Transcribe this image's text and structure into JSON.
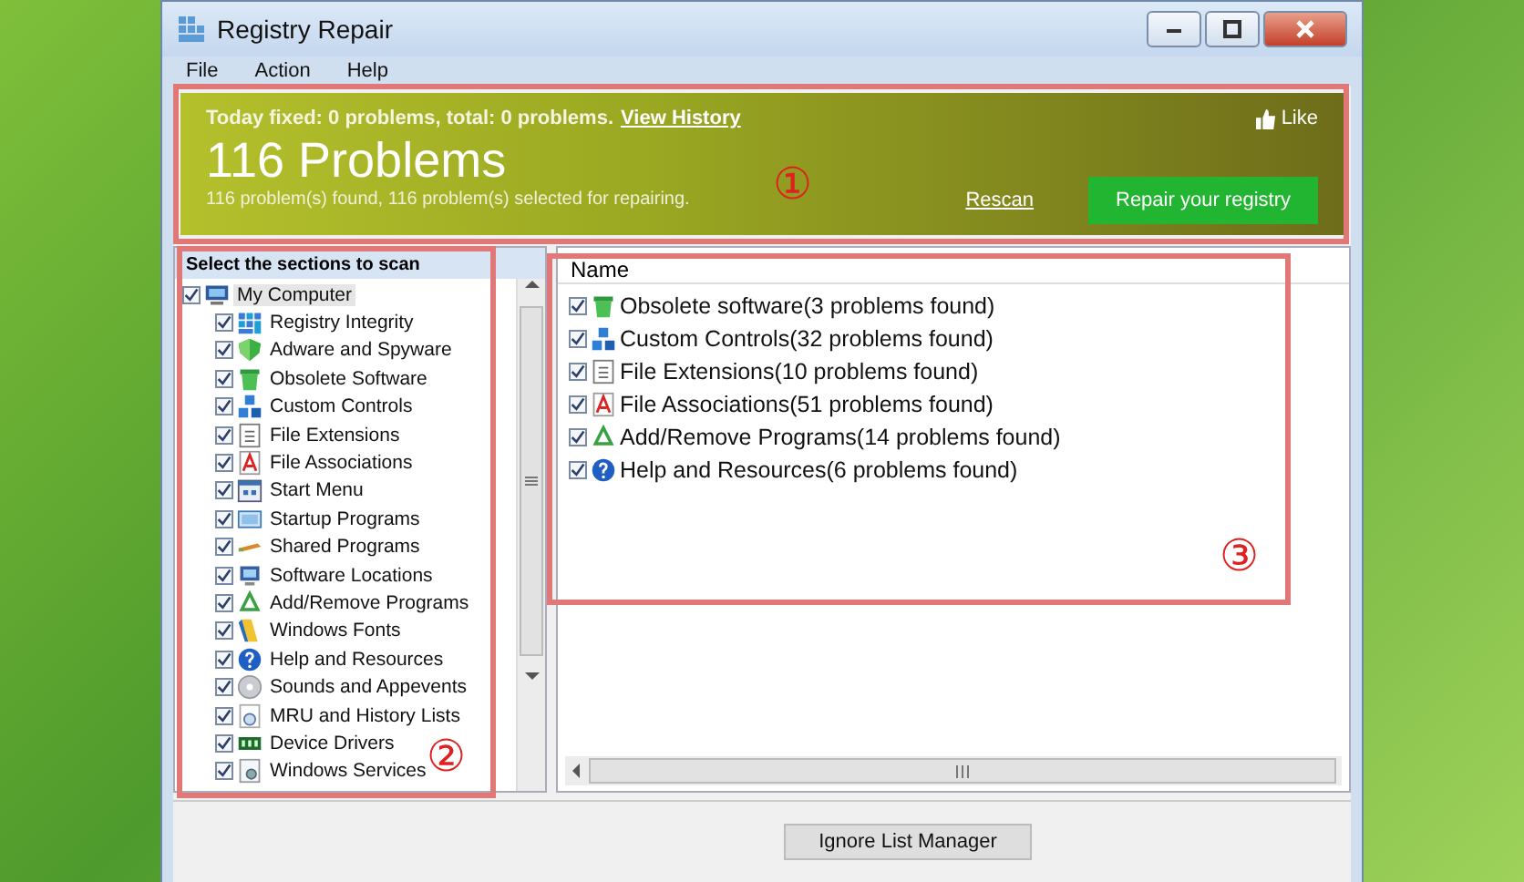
{
  "window": {
    "title": "Registry Repair"
  },
  "menu": [
    "File",
    "Action",
    "Help"
  ],
  "banner": {
    "summary": "Today fixed: 0 problems, total: 0 problems.",
    "history_link": "View History",
    "like": "Like",
    "headline": "116 Problems",
    "detail": "116 problem(s) found, 116 problem(s) selected for repairing.",
    "rescan": "Rescan",
    "repair_button": "Repair your registry"
  },
  "sections": {
    "title": "Select the sections to scan",
    "tree": [
      {
        "label": "My Computer",
        "checked": true,
        "selected": true,
        "children": [
          {
            "label": "Registry Integrity",
            "checked": true
          },
          {
            "label": "Adware and Spyware",
            "checked": true
          },
          {
            "label": "Obsolete Software",
            "checked": true
          },
          {
            "label": "Custom Controls",
            "checked": true
          },
          {
            "label": "File Extensions",
            "checked": true
          },
          {
            "label": "File Associations",
            "checked": true
          },
          {
            "label": "Start Menu",
            "checked": true
          },
          {
            "label": "Startup Programs",
            "checked": true
          },
          {
            "label": "Shared Programs",
            "checked": true
          },
          {
            "label": "Software Locations",
            "checked": true
          },
          {
            "label": "Add/Remove Programs",
            "checked": true
          },
          {
            "label": "Windows Fonts",
            "checked": true
          },
          {
            "label": "Help and Resources",
            "checked": true
          },
          {
            "label": "Sounds and Appevents",
            "checked": true
          },
          {
            "label": "MRU and History Lists",
            "checked": true
          },
          {
            "label": "Device Drivers",
            "checked": true
          },
          {
            "label": "Windows Services",
            "checked": true
          }
        ]
      }
    ]
  },
  "results": {
    "column": "Name",
    "rows": [
      {
        "label": "Obsolete software(3 problems found)",
        "checked": true
      },
      {
        "label": "Custom Controls(32 problems found)",
        "checked": true
      },
      {
        "label": "File Extensions(10 problems found)",
        "checked": true
      },
      {
        "label": "File Associations(51 problems found)",
        "checked": true
      },
      {
        "label": "Add/Remove Programs(14 problems found)",
        "checked": true
      },
      {
        "label": "Help and Resources(6 problems found)",
        "checked": true
      }
    ]
  },
  "footer_button": "Ignore List Manager",
  "annotations": [
    {
      "label": "①"
    },
    {
      "label": "②"
    },
    {
      "label": "③"
    }
  ]
}
